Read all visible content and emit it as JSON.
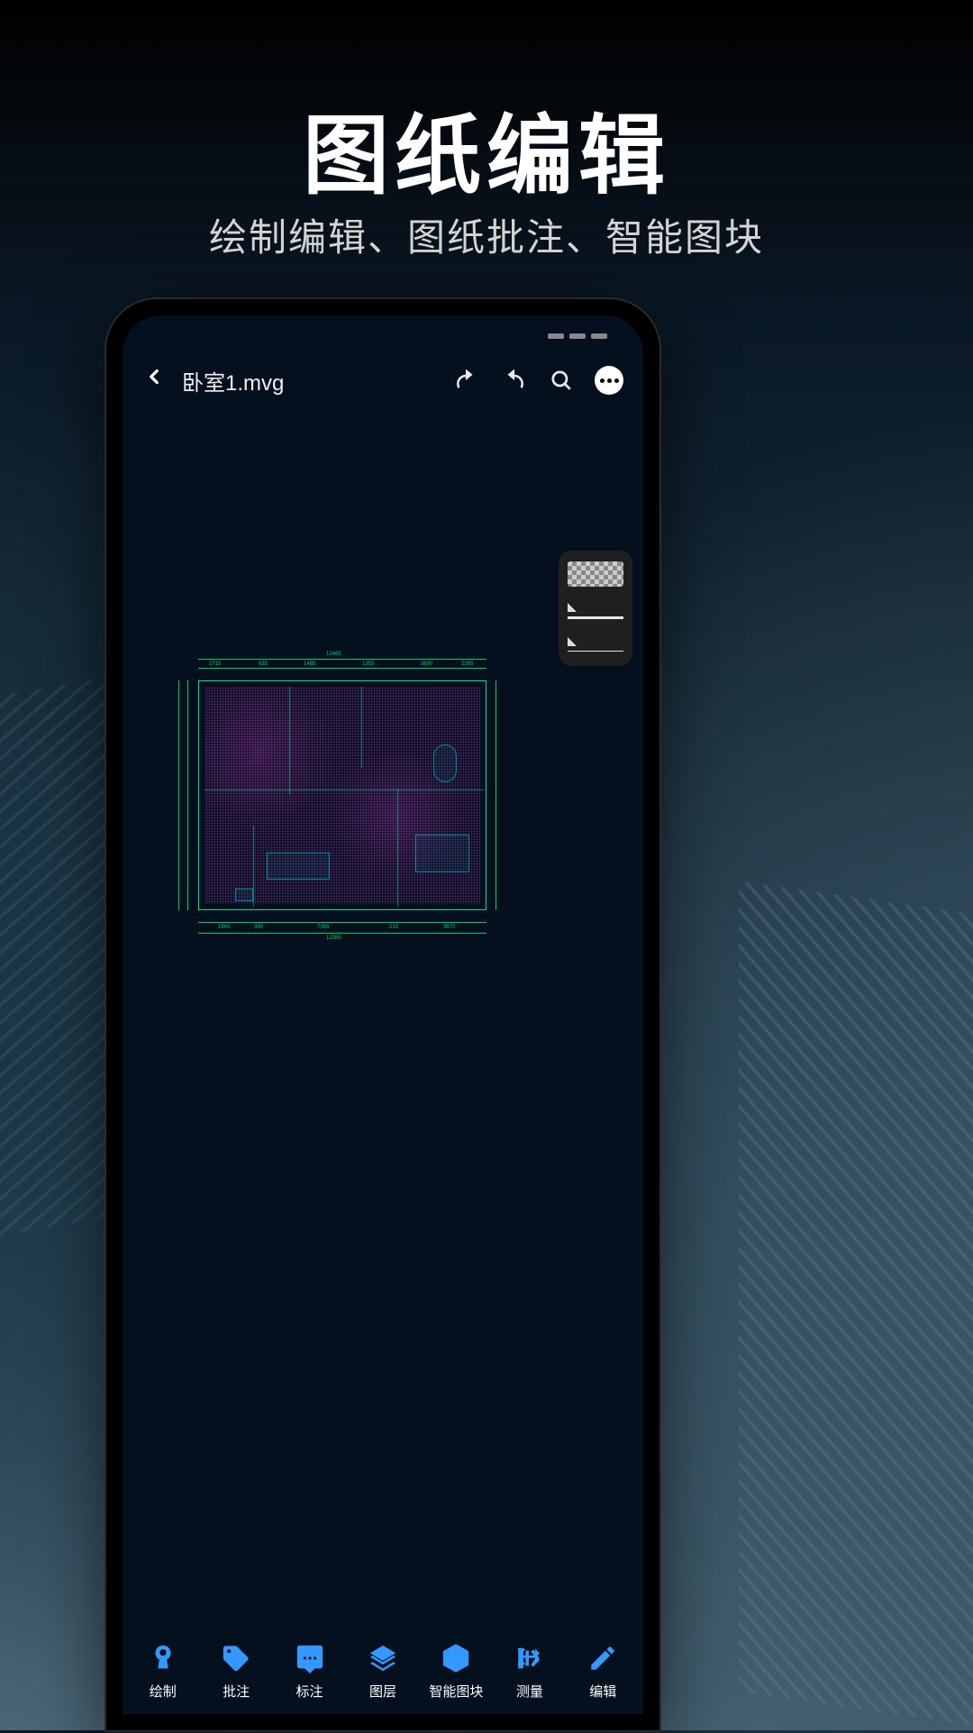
{
  "marketing": {
    "title": "图纸编辑",
    "subtitle": "绘制编辑、图纸批注、智能图块"
  },
  "app": {
    "filename": "卧室1.mvg",
    "header_icons": {
      "back": "back-icon",
      "undo": "undo-icon",
      "redo": "redo-icon",
      "search": "search-icon",
      "more": "more-icon"
    }
  },
  "floor_plan": {
    "dimensions_top": [
      "2715",
      "935",
      "1485",
      "1355",
      "3690",
      "2285"
    ],
    "dimension_top_total": "12465",
    "dimensions_bottom": [
      "1945",
      "390",
      "7365",
      "215",
      "3670"
    ],
    "dimension_bottom_total": "12385"
  },
  "floating_panel": {
    "items": [
      "checker-swatch",
      "solid-line-thick",
      "solid-line-thin"
    ]
  },
  "toolbar": {
    "items": [
      {
        "id": "draw",
        "label": "绘制",
        "icon": "pen-icon"
      },
      {
        "id": "annotate",
        "label": "批注",
        "icon": "tag-icon"
      },
      {
        "id": "markup",
        "label": "标注",
        "icon": "comment-icon"
      },
      {
        "id": "layers",
        "label": "图层",
        "icon": "layers-icon"
      },
      {
        "id": "blocks",
        "label": "智能图块",
        "icon": "cube-icon"
      },
      {
        "id": "measure",
        "label": "测量",
        "icon": "measure-icon"
      },
      {
        "id": "edit",
        "label": "编辑",
        "icon": "edit-icon"
      }
    ]
  },
  "colors": {
    "accent": "#3399ff",
    "cad_green": "#00d070",
    "cad_magenta": "#c83cc8",
    "screen_bg": "#04101e"
  }
}
